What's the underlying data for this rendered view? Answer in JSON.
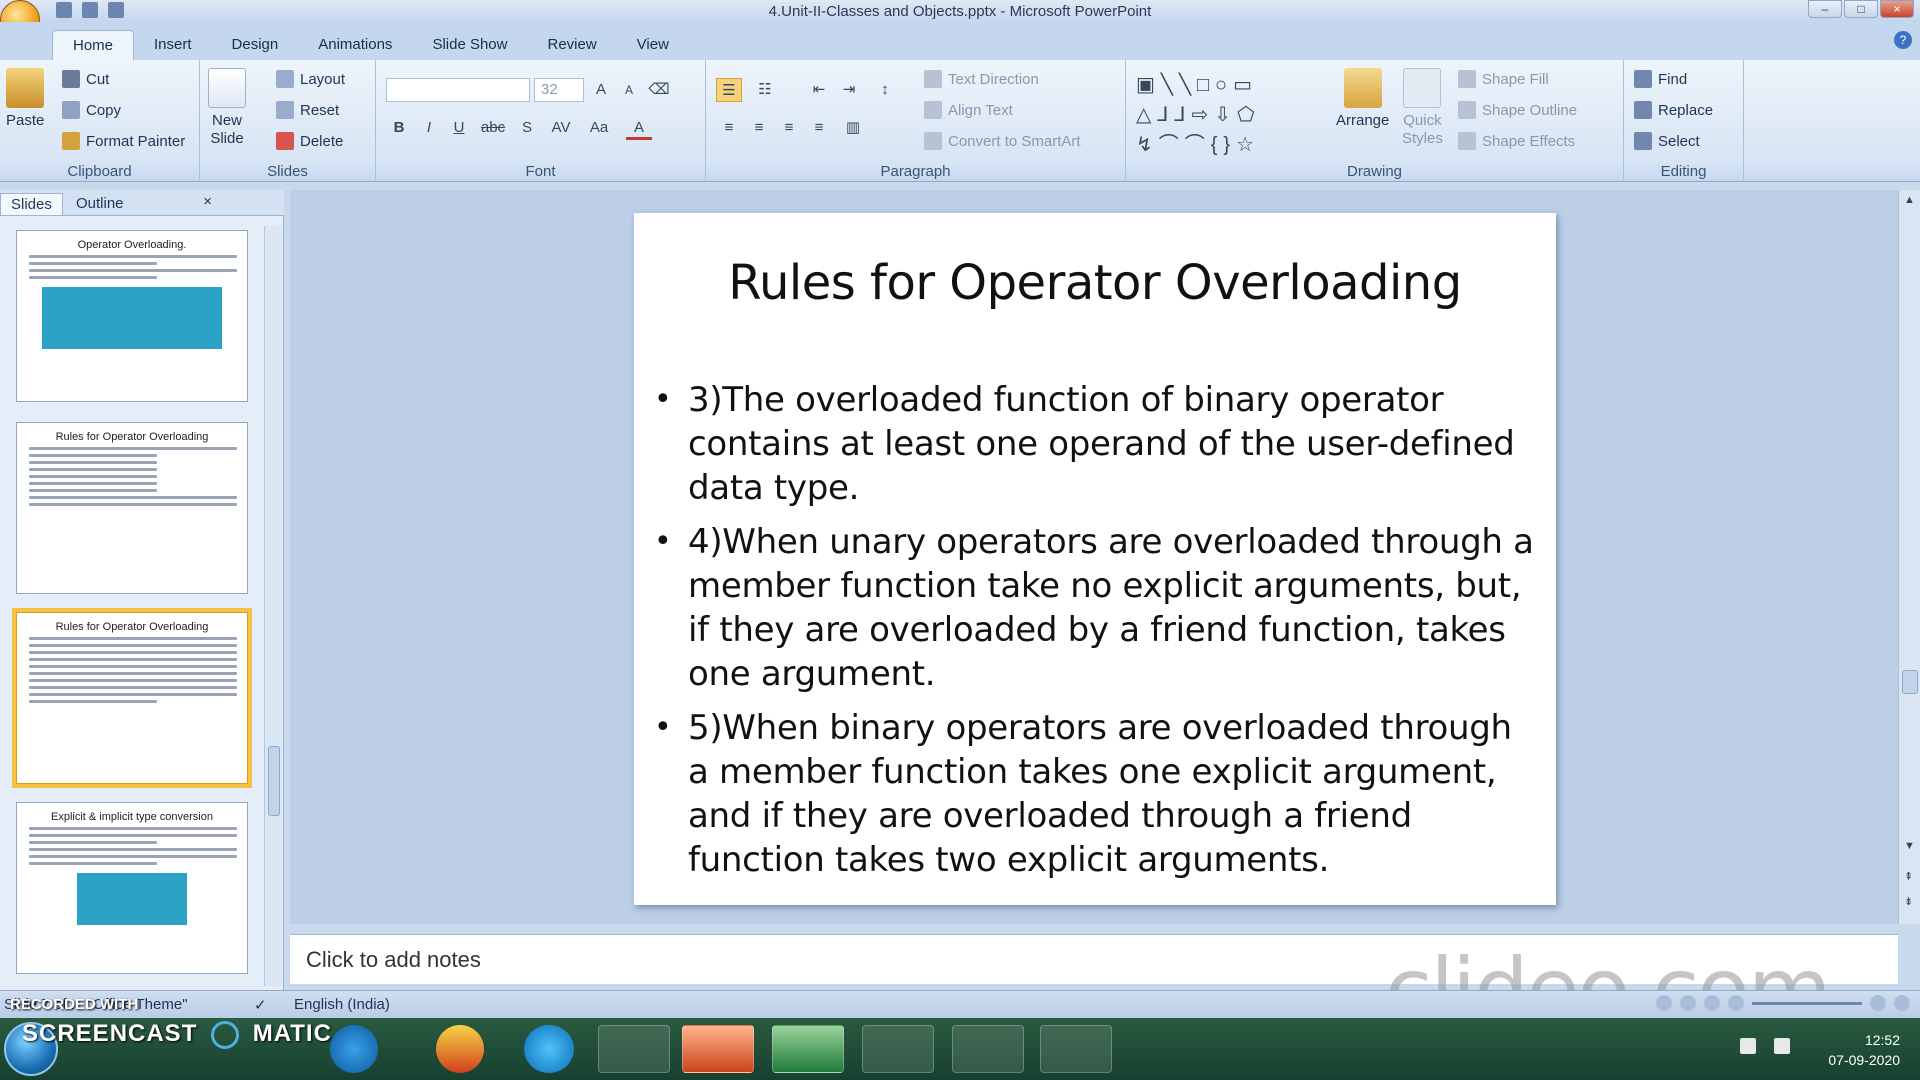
{
  "window": {
    "title": "4.Unit-II-Classes and Objects.pptx - Microsoft PowerPoint"
  },
  "tabs": [
    "Home",
    "Insert",
    "Design",
    "Animations",
    "Slide Show",
    "Review",
    "View"
  ],
  "ribbon": {
    "clipboard": {
      "label": "Clipboard",
      "paste": "Paste",
      "cut": "Cut",
      "copy": "Copy",
      "format_painter": "Format Painter"
    },
    "slides": {
      "label": "Slides",
      "new_slide_line1": "New",
      "new_slide_line2": "Slide",
      "layout": "Layout",
      "reset": "Reset",
      "delete": "Delete"
    },
    "font": {
      "label": "Font",
      "size": "32",
      "bold": "B",
      "italic": "I",
      "underline": "U",
      "strike": "abc",
      "shadow": "S",
      "spacing": "AV",
      "case": "Aa",
      "grow": "A",
      "shrink": "A"
    },
    "paragraph": {
      "label": "Paragraph",
      "text_direction": "Text Direction",
      "align_text": "Align Text",
      "convert_smartart": "Convert to SmartArt"
    },
    "drawing": {
      "label": "Drawing",
      "arrange": "Arrange",
      "quick_styles_line1": "Quick",
      "quick_styles_line2": "Styles",
      "shape_fill": "Shape Fill",
      "shape_outline": "Shape Outline",
      "shape_effects": "Shape Effects"
    },
    "editing": {
      "label": "Editing",
      "find": "Find",
      "replace": "Replace",
      "select": "Select"
    }
  },
  "pane": {
    "tab_slides": "Slides",
    "tab_outline": "Outline",
    "close": "×",
    "thumbnails": [
      {
        "title": "Operator Overloading.",
        "selected": false
      },
      {
        "title": "Rules for Operator Overloading",
        "selected": false
      },
      {
        "title": "Rules for Operator Overloading",
        "selected": true
      },
      {
        "title": "Explicit & implicit type conversion",
        "selected": false
      }
    ]
  },
  "slide": {
    "title": "Rules for Operator Overloading",
    "bullets": [
      "3)The overloaded function of binary operator contains at least one operand of the user-defined data type.",
      "4)When unary operators are overloaded through a member function take no explicit arguments, but, if they are overloaded by a friend function, takes one argument.",
      "5)When binary operators are overloaded through a member function takes one explicit argument, and if they are overloaded through a friend function takes two explicit arguments."
    ]
  },
  "notes": {
    "placeholder": "Click to add notes"
  },
  "watermark": "clideo.com",
  "statusbar": {
    "slide_info": "Slide 7 of ... \"Office Theme\"",
    "recorded": "RECORDED WITH",
    "language": "English (India)"
  },
  "taskbar": {
    "screencast": "SCREENCAST",
    "matic": "MATIC",
    "time": "12:52",
    "date": "07-09-2020"
  },
  "colors": {
    "ribbon_bg": "#d7e4f4",
    "selected_thumb": "#f5c244",
    "thumb_box": "#2aa3c7",
    "taskbar": "#174030"
  }
}
